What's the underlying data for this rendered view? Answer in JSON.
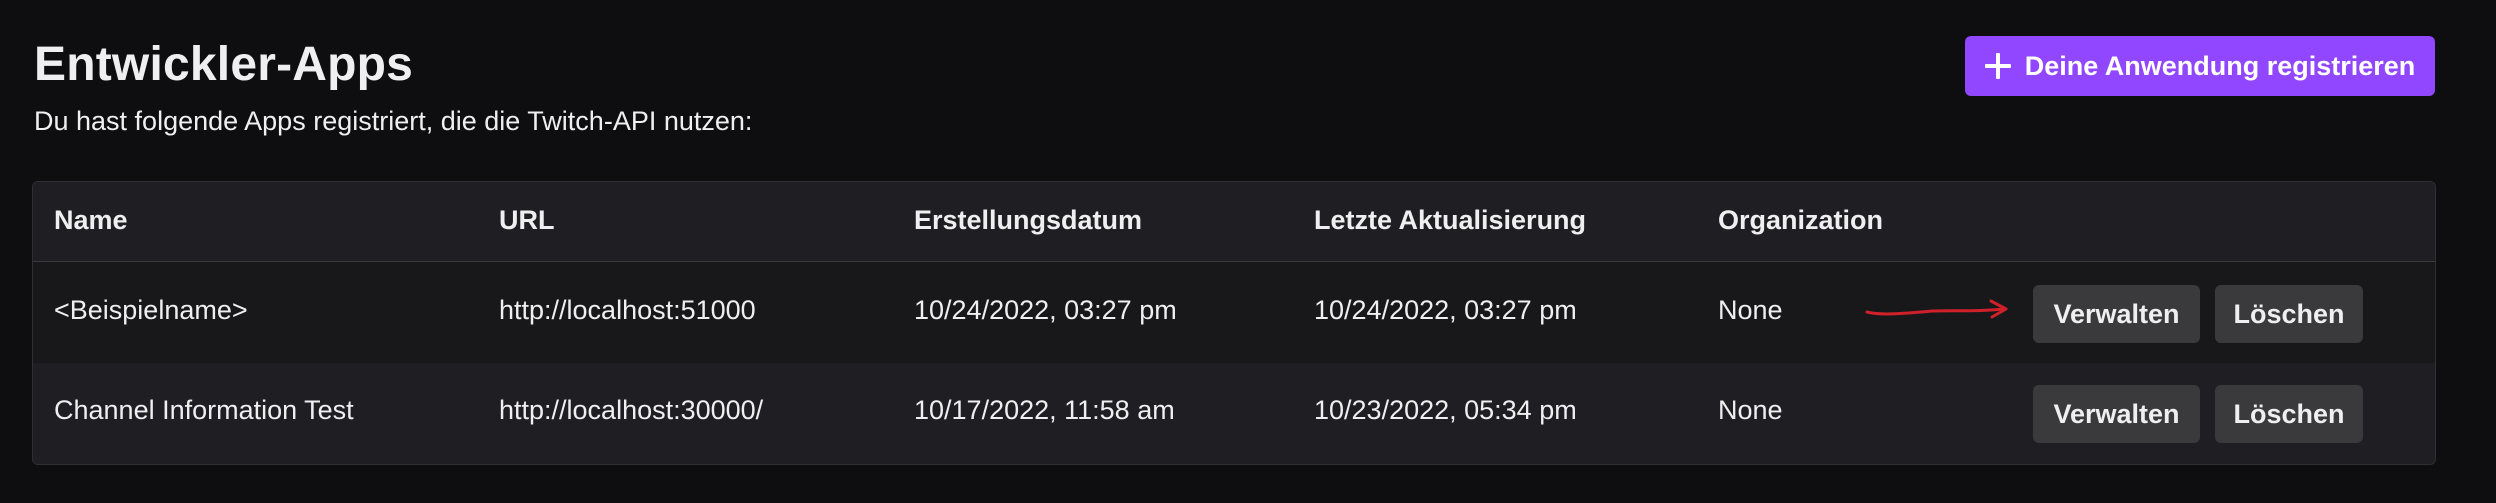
{
  "header": {
    "title": "Entwickler-Apps",
    "subtitle": "Du hast folgende Apps registriert, die die Twitch-API nutzen:",
    "register_button_label": "Deine Anwendung registrieren"
  },
  "table": {
    "columns": [
      "Name",
      "URL",
      "Erstellungsdatum",
      "Letzte Aktualisierung",
      "Organization"
    ],
    "rows": [
      {
        "name": "<Beispielname>",
        "url": "http://localhost:51000",
        "created": "10/24/2022, 03:27 pm",
        "updated": "10/24/2022, 03:27 pm",
        "organization": "None",
        "manage_label": "Verwalten",
        "delete_label": "Löschen"
      },
      {
        "name": "Channel Information Test",
        "url": "http://localhost:30000/",
        "created": "10/17/2022, 11:58 am",
        "updated": "10/23/2022, 05:34 pm",
        "organization": "None",
        "manage_label": "Verwalten",
        "delete_label": "Löschen"
      }
    ]
  },
  "colors": {
    "background": "#0e0e10",
    "accent": "#9147ff",
    "table_bg": "#18181b",
    "button_bg": "#3a3a3d",
    "annotation_arrow": "#d0202a"
  },
  "icons": {
    "register_button": "plus-icon",
    "annotation": "red-arrow-annotation"
  }
}
